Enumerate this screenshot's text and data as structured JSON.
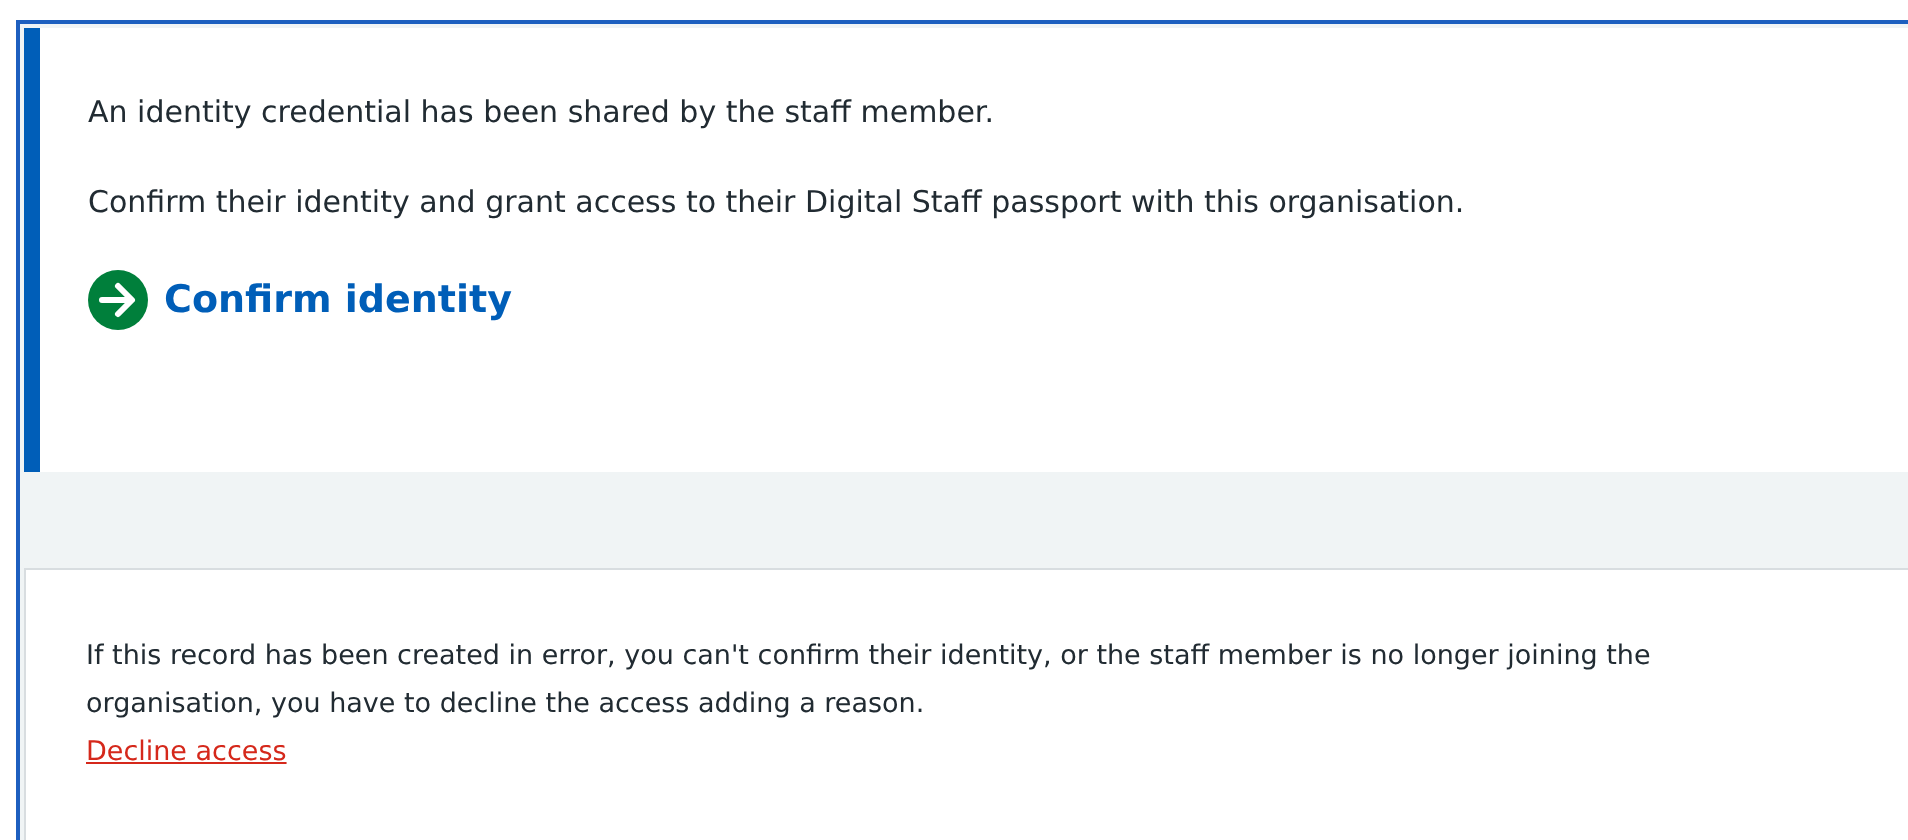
{
  "identity_panel": {
    "message": "An identity credential has been shared by the staff member.",
    "instruction": "Confirm their identity and grant access to their Digital Staff passport with this organisation.",
    "action": "Confirm identity"
  },
  "decline_panel": {
    "message": "If this record has been created in error, you can't confirm their identity, or the staff member is no longer joining the organisation, you have to decline the access adding a reason.",
    "link": "Decline access"
  }
}
